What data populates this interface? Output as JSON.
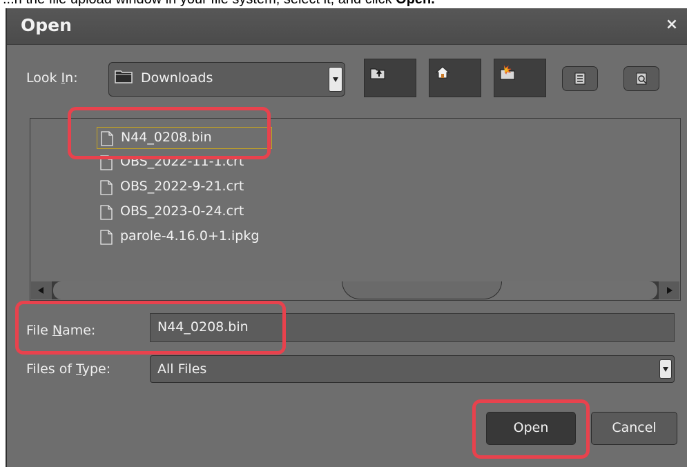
{
  "caption": {
    "text": "...n the file upload window in your file system, select it, and click ",
    "bold": "Open."
  },
  "dialog": {
    "title": "Open",
    "close_symbol": "×"
  },
  "look_in": {
    "label_pre": "Look ",
    "label_mnemonic": "I",
    "label_post": "n:",
    "value": "Downloads",
    "icon": "folder-icon"
  },
  "toolbar": {
    "buttons": [
      {
        "name": "up-one-level-icon"
      },
      {
        "name": "home-icon"
      },
      {
        "name": "new-folder-icon"
      }
    ],
    "view_buttons": [
      {
        "name": "list-view-icon"
      },
      {
        "name": "details-view-icon"
      }
    ]
  },
  "files": [
    {
      "name": "N44_0208.bin",
      "selected": true
    },
    {
      "name": "OBS_2022-11-1.crt",
      "selected": false
    },
    {
      "name": "OBS_2022-9-21.crt",
      "selected": false
    },
    {
      "name": "OBS_2023-0-24.crt",
      "selected": false
    },
    {
      "name": "parole-4.16.0+1.ipkg",
      "selected": false
    }
  ],
  "file_name": {
    "label_pre": "File ",
    "label_mnemonic": "N",
    "label_post": "ame:",
    "value": "N44_0208.bin"
  },
  "files_of_type": {
    "label_pre": "Files of ",
    "label_mnemonic": "T",
    "label_post": "ype:",
    "value": "All Files"
  },
  "buttons": {
    "open": "Open",
    "cancel": "Cancel"
  },
  "colors": {
    "dialog_bg": "#6e6e6e",
    "titlebar_bg": "#4f4f4f",
    "highlight": "#e8424d",
    "selection_border": "#c8a51e"
  }
}
